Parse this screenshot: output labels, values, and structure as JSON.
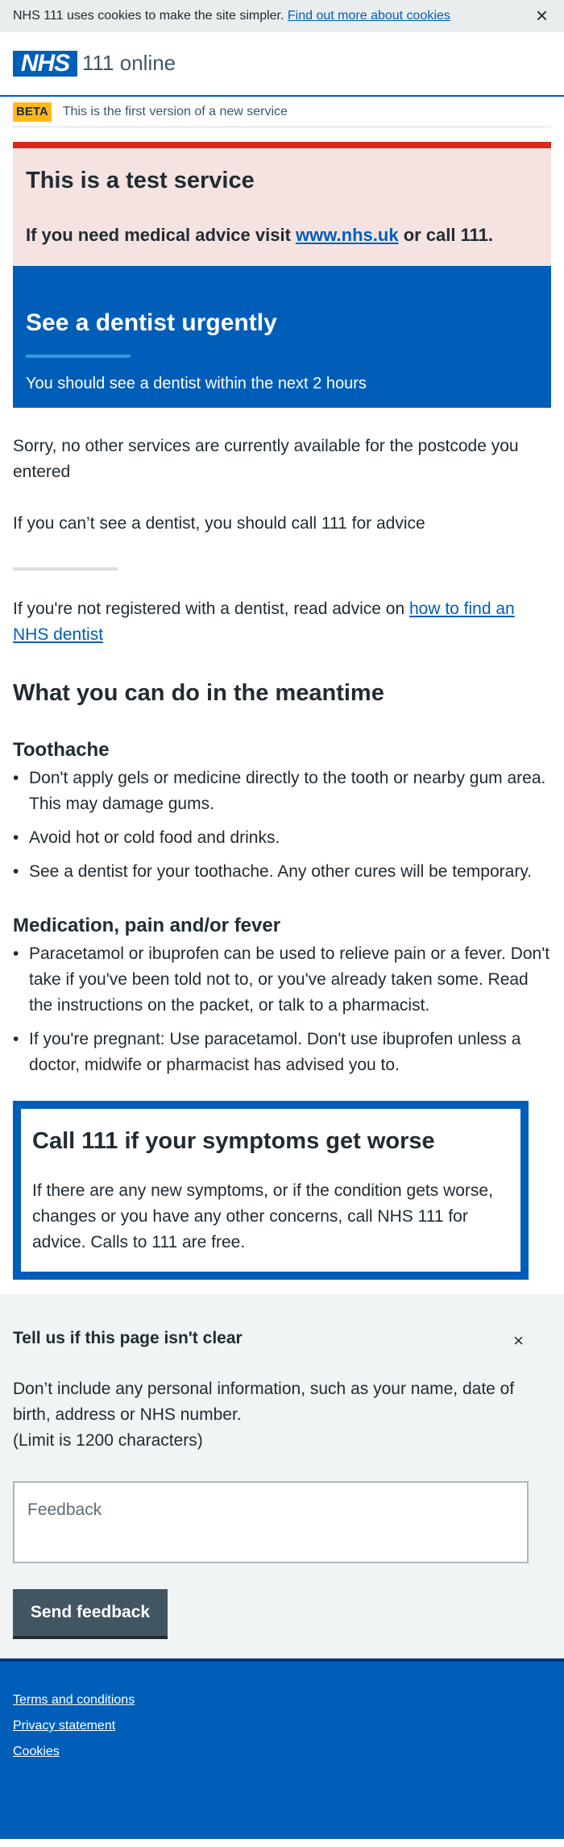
{
  "cookie_bar": {
    "text": "NHS 111 uses cookies to make the site simpler.",
    "link": "Find out more about cookies",
    "close": "×"
  },
  "header": {
    "logo": "NHS",
    "service_name": "111 online"
  },
  "beta": {
    "tag": "BETA",
    "text": "This is the first version of a new service"
  },
  "test_banner": {
    "title": "This is a test service",
    "text_before": "If you need medical advice visit",
    "link": "www.nhs.uk",
    "text_after": "or call 111."
  },
  "care_card": {
    "title": "See a dentist urgently",
    "text": "You should see a dentist within the next 2 hours"
  },
  "main": {
    "no_services": "Sorry, no other services are currently available for the postcode you entered",
    "call_advice": "If you can’t see a dentist, you should call 111 for advice",
    "registered_before": "If you're not registered with a dentist, read advice on",
    "registered_link": "how to find an NHS dentist",
    "meantime_heading": "What you can do in the meantime",
    "toothache_heading": "Toothache",
    "toothache_items": [
      "Don't apply gels or medicine directly to the tooth or nearby gum area. This may damage gums.",
      "Avoid hot or cold food and drinks.",
      "See a dentist for your toothache. Any other cures will be temporary."
    ],
    "medication_heading": "Medication, pain and/or fever",
    "medication_items": [
      "Paracetamol or ibuprofen can be used to relieve pain or a fever. Don't take if you've been told not to, or you've already taken some. Read the instructions on the packet, or talk to a pharmacist.",
      "If you're pregnant: Use paracetamol. Don't use ibuprofen unless a doctor, midwife or pharmacist has advised you to."
    ]
  },
  "callout": {
    "title": "Call 111 if your symptoms get worse",
    "text": "If there are any new symptoms, or if the condition gets worse, changes or you have any other concerns, call NHS 111 for advice. Calls to 111 are free."
  },
  "feedback": {
    "title": "Tell us if this page isn't clear",
    "close": "×",
    "info": "Don’t include any personal information, such as your name, date of birth, address or NHS number.",
    "limit": "(Limit is 1200 characters)",
    "placeholder": "Feedback",
    "button": "Send feedback"
  },
  "footer": {
    "links": [
      "Terms and conditions",
      "Privacy statement",
      "Cookies"
    ]
  },
  "colors": {
    "nhs_blue": "#005eb8",
    "beta_yellow": "#ffb81c",
    "test_red": "#da291c",
    "test_bg": "#f4e3e1",
    "feedback_bg": "#f0f4f5"
  }
}
